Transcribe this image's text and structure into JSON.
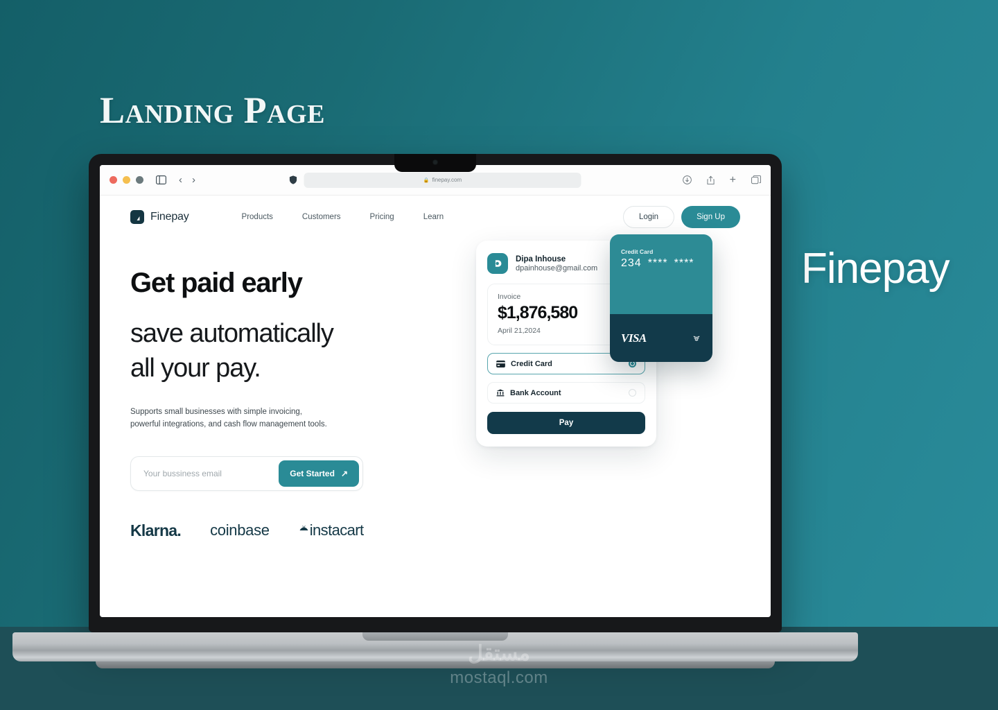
{
  "slide": {
    "title": "Landing Page",
    "brand_right": "Finepay",
    "background_accent": "#1a6b74"
  },
  "browser": {
    "url": "finepay.com",
    "traffic_lights": [
      "close",
      "minimize",
      "maximize"
    ],
    "icons": {
      "sidebar": "sidebar-icon",
      "back": "‹",
      "forward": "›",
      "shield": "shield-icon",
      "lock": "lock-icon",
      "download": "download-icon",
      "share": "share-icon",
      "new_tab": "+",
      "tabs": "tabs-icon"
    }
  },
  "site": {
    "logo_text": "Finepay",
    "nav_links": [
      {
        "label": "Products"
      },
      {
        "label": "Customers"
      },
      {
        "label": "Pricing"
      },
      {
        "label": "Learn"
      }
    ],
    "login_label": "Login",
    "signup_label": "Sign Up",
    "hero": {
      "headline_bold": "Get paid early",
      "headline_light_line1": "save automatically",
      "headline_light_line2": "all your pay.",
      "subtitle_line1": "Supports small businesses with simple invoicing,",
      "subtitle_line2": "powerful integrations, and cash flow management tools.",
      "email_placeholder": "Your bussiness email",
      "email_value": "",
      "cta_label": "Get Started",
      "cta_arrow": "↗"
    },
    "partners": [
      {
        "name": "Klarna."
      },
      {
        "name": "coinbase"
      },
      {
        "name": "instacart"
      }
    ]
  },
  "payment_widget": {
    "payer_name": "Dipa Inhouse",
    "payer_email": "dpainhouse@gmail.com",
    "invoice_label": "Invoice",
    "invoice_amount": "$1,876,580",
    "invoice_date": "April 21,2024",
    "methods": [
      {
        "label": "Credit Card",
        "icon": "credit-card-icon",
        "selected": true
      },
      {
        "label": "Bank Account",
        "icon": "bank-icon",
        "selected": false
      }
    ],
    "pay_label": "Pay",
    "accent_color": "#2a8b96",
    "dark_color": "#123a4a"
  },
  "credit_card": {
    "label": "Credit Card",
    "number_prefix": "234",
    "number_masked_1": "****",
    "number_masked_2": "****",
    "network": "VISA",
    "contactless": ")))",
    "top_color": "#2d8b95",
    "bottom_color": "#123a4a"
  },
  "watermark": {
    "logo_arabic": "مستقل",
    "url": "mostaql.com"
  }
}
